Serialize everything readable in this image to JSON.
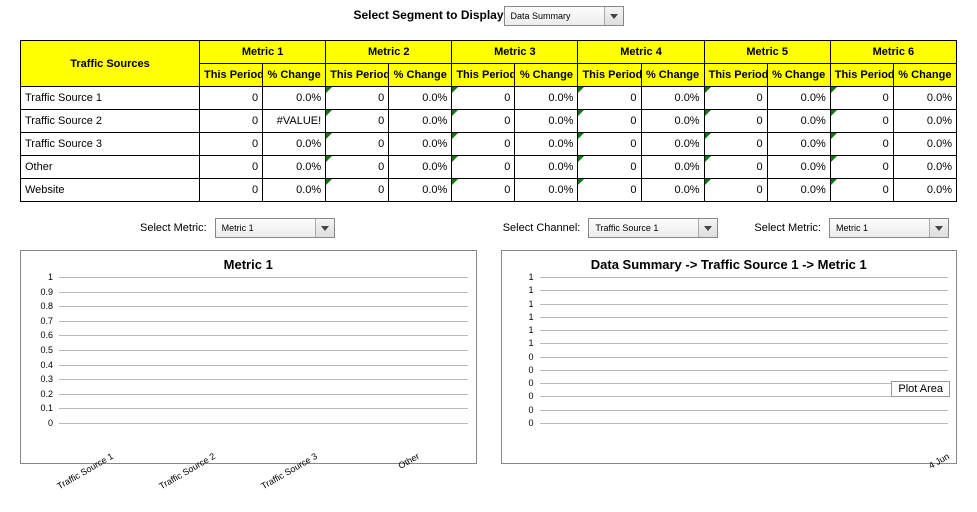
{
  "top_selector": {
    "label": "Select Segment to Display",
    "value": "Data Summary"
  },
  "table": {
    "corner": "Traffic Sources",
    "metrics": [
      "Metric 1",
      "Metric 2",
      "Metric 3",
      "Metric 4",
      "Metric 5",
      "Metric 6"
    ],
    "sub_headers": [
      "This Period",
      "% Change"
    ],
    "rows": [
      {
        "name": "Traffic Source 1",
        "cells": [
          [
            "0",
            "0.0%"
          ],
          [
            "0",
            "0.0%"
          ],
          [
            "0",
            "0.0%"
          ],
          [
            "0",
            "0.0%"
          ],
          [
            "0",
            "0.0%"
          ],
          [
            "0",
            "0.0%"
          ]
        ]
      },
      {
        "name": "Traffic Source 2",
        "cells": [
          [
            "0",
            "#VALUE!"
          ],
          [
            "0",
            "0.0%"
          ],
          [
            "0",
            "0.0%"
          ],
          [
            "0",
            "0.0%"
          ],
          [
            "0",
            "0.0%"
          ],
          [
            "0",
            "0.0%"
          ]
        ]
      },
      {
        "name": "Traffic Source 3",
        "cells": [
          [
            "0",
            "0.0%"
          ],
          [
            "0",
            "0.0%"
          ],
          [
            "0",
            "0.0%"
          ],
          [
            "0",
            "0.0%"
          ],
          [
            "0",
            "0.0%"
          ],
          [
            "0",
            "0.0%"
          ]
        ]
      },
      {
        "name": "Other",
        "cells": [
          [
            "0",
            "0.0%"
          ],
          [
            "0",
            "0.0%"
          ],
          [
            "0",
            "0.0%"
          ],
          [
            "0",
            "0.0%"
          ],
          [
            "0",
            "0.0%"
          ],
          [
            "0",
            "0.0%"
          ]
        ]
      },
      {
        "name": "Website",
        "cells": [
          [
            "0",
            "0.0%"
          ],
          [
            "0",
            "0.0%"
          ],
          [
            "0",
            "0.0%"
          ],
          [
            "0",
            "0.0%"
          ],
          [
            "0",
            "0.0%"
          ],
          [
            "0",
            "0.0%"
          ]
        ]
      }
    ]
  },
  "selectors": {
    "metric_left": {
      "label": "Select Metric:",
      "value": "Metric 1"
    },
    "channel": {
      "label": "Select Channel:",
      "value": "Traffic Source 1"
    },
    "metric_right": {
      "label": "Select Metric:",
      "value": "Metric 1"
    }
  },
  "chart_left": {
    "title": "Metric 1",
    "yticks": [
      "1",
      "0.9",
      "0.8",
      "0.7",
      "0.6",
      "0.5",
      "0.4",
      "0.3",
      "0.2",
      "0.1",
      "0"
    ],
    "xticks": [
      "Traffic Source 1",
      "Traffic Source 2",
      "Traffic Source 3",
      "Other"
    ]
  },
  "chart_right": {
    "title": "Data Summary -> Traffic Source 1 -> Metric 1",
    "yticks": [
      "1",
      "1",
      "1",
      "1",
      "1",
      "1",
      "0",
      "0",
      "0",
      "0",
      "0",
      "0"
    ],
    "xticks": [
      "4 Jun"
    ],
    "badge": "Plot Area"
  },
  "chart_data": [
    {
      "type": "bar",
      "title": "Metric 1",
      "categories": [
        "Traffic Source 1",
        "Traffic Source 2",
        "Traffic Source 3",
        "Other"
      ],
      "values": [
        0,
        0,
        0,
        0
      ],
      "ylim": [
        0,
        1
      ]
    },
    {
      "type": "line",
      "title": "Data Summary -> Traffic Source 1 -> Metric 1",
      "x": [
        "4 Jun"
      ],
      "values": [
        0
      ],
      "ylim": [
        0,
        1
      ]
    }
  ]
}
